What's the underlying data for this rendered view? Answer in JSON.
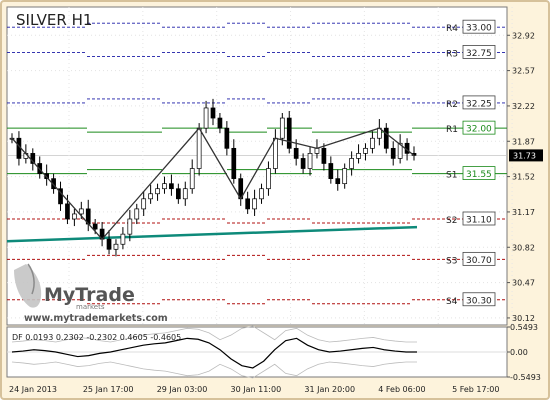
{
  "chart_data": {
    "type": "candlestick",
    "title": "SILVER H1",
    "symbol": "SILVER",
    "timeframe": "H1",
    "watermark": {
      "brand": "MyTrade",
      "tagline": "markets",
      "url": "www.mytrademarkets.com"
    },
    "ylim": [
      30.05,
      33.2
    ],
    "y_ticks": [
      "32.92",
      "32.57",
      "32.22",
      "31.87",
      "31.52",
      "31.17",
      "30.82",
      "30.47",
      "30.12"
    ],
    "current_price": "31.73",
    "x_ticks": [
      "24 Jan 2013",
      "25 Jan 17:00",
      "29 Jan 03:00",
      "30 Jan 11:00",
      "31 Jan 20:00",
      "4 Feb 06:00",
      "5 Feb 17:00"
    ],
    "levels": [
      {
        "name": "R4",
        "value": "33.00",
        "color": "#1a1aa6"
      },
      {
        "name": "R3",
        "value": "32.75",
        "color": "#1a1aa6"
      },
      {
        "name": "R2",
        "value": "32.25",
        "color": "#1a1aa6"
      },
      {
        "name": "R1",
        "value": "32.00",
        "color": "#1a8a1a"
      },
      {
        "name": "S1",
        "value": "31.55",
        "color": "#1a8a1a"
      },
      {
        "name": "S2",
        "value": "31.10",
        "color": "#b01010"
      },
      {
        "name": "S3",
        "value": "30.70",
        "color": "#b01010"
      },
      {
        "name": "S4",
        "value": "30.30",
        "color": "#b01010"
      }
    ],
    "trendline": {
      "from": 30.88,
      "to": 31.02,
      "color": "#0e8a7a"
    },
    "price_path": [
      31.9,
      31.7,
      31.75,
      31.65,
      31.55,
      31.5,
      31.4,
      31.25,
      31.1,
      31.15,
      31.2,
      31.05,
      31.0,
      30.9,
      30.8,
      30.85,
      30.95,
      31.1,
      31.2,
      31.3,
      31.35,
      31.4,
      31.45,
      31.4,
      31.3,
      31.4,
      31.6,
      32.0,
      32.2,
      32.1,
      32.0,
      31.8,
      31.5,
      31.3,
      31.2,
      31.3,
      31.4,
      31.6,
      31.9,
      32.1,
      31.8,
      31.7,
      31.6,
      31.75,
      31.8,
      31.65,
      31.5,
      31.45,
      31.6,
      31.7,
      31.75,
      31.8,
      31.9,
      32.0,
      31.8,
      31.7,
      31.85,
      31.75,
      31.73
    ],
    "indicator": {
      "label": "DF 0.0193 0.2302 -0.2302 0.4605 -0.4605",
      "y_ticks": [
        "0.5493",
        "0.00",
        "-0.5493"
      ],
      "series": [
        0.0,
        0.02,
        0.05,
        0.03,
        0.0,
        -0.05,
        -0.1,
        -0.08,
        -0.03,
        0.0,
        0.05,
        0.1,
        0.15,
        0.18,
        0.2,
        0.25,
        0.3,
        0.28,
        0.2,
        0.05,
        -0.15,
        -0.3,
        -0.35,
        -0.2,
        0.05,
        0.25,
        0.3,
        0.15,
        0.05,
        0.0,
        0.02,
        0.05,
        0.08,
        0.1,
        0.05,
        0.02,
        0.0,
        0.0
      ]
    }
  }
}
